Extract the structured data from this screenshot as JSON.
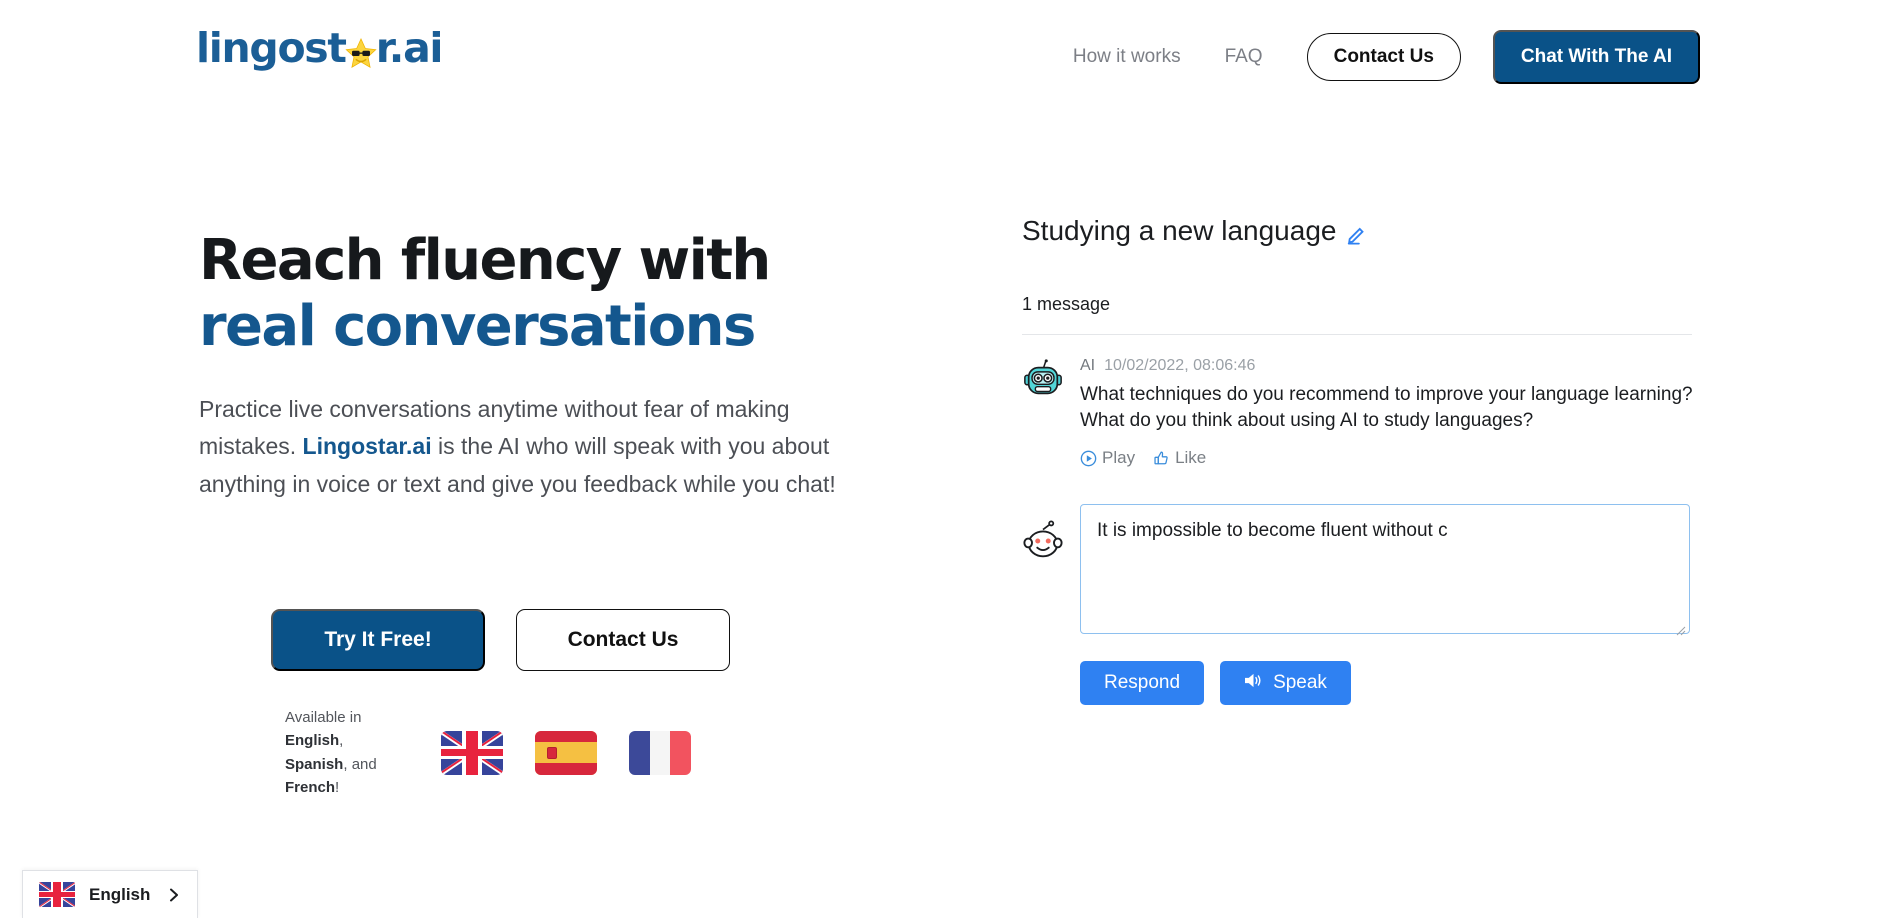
{
  "header": {
    "logo": {
      "text_before": "lingost",
      "star_icon": "star-sunglasses-emoji",
      "text_after": "r.ai"
    },
    "nav_links": [
      {
        "label": "How it works",
        "name": "nav-how-it-works"
      },
      {
        "label": "FAQ",
        "name": "nav-faq"
      }
    ],
    "contact_button": "Contact Us",
    "chat_button": "Chat With The AI"
  },
  "hero": {
    "headline_line1": "Reach fluency with",
    "headline_line2": "real conversations",
    "paragraph_part1": "Practice live conversations anytime without fear of making mistakes. ",
    "paragraph_link": "Lingostar.ai",
    "paragraph_part2": " is the AI who will speak with you about anything in voice or text and give you feedback while you chat!",
    "cta_primary": "Try It Free!",
    "cta_secondary": "Contact Us",
    "availability": {
      "prefix": "Available in ",
      "lang1": "English",
      "sep1": ", ",
      "lang2": "Spanish",
      "sep2": ", and ",
      "lang3": "French",
      "suffix": "!"
    },
    "flags": [
      "uk-flag",
      "spain-flag",
      "france-flag"
    ]
  },
  "chat": {
    "title": "Studying a new language",
    "edit_icon": "pencil-edit-icon",
    "message_count": "1 message",
    "messages": [
      {
        "author": "AI",
        "timestamp": "10/02/2022, 08:06:46",
        "avatar": "robot-avatar-icon",
        "text": "What techniques do you recommend to improve your language learning? What do you think about using AI to study languages?",
        "actions": [
          {
            "label": "Play",
            "icon": "play-circle-icon"
          },
          {
            "label": "Like",
            "icon": "thumbs-up-icon"
          }
        ]
      }
    ],
    "compose": {
      "avatar": "user-avatar-icon",
      "value": "It is impossible to become fluent without c",
      "placeholder": "",
      "respond_button": "Respond",
      "speak_button": "Speak",
      "speak_icon": "speaker-icon"
    }
  },
  "language_widget": {
    "flag": "uk-flag",
    "label": "English",
    "chevron": "chevron-right-icon"
  },
  "colors": {
    "brand_navy": "#0a5288",
    "accent_blue": "#14578e",
    "button_blue": "#2f81f2",
    "text_dark": "#1b1d20",
    "text_muted": "#7c7f86"
  }
}
